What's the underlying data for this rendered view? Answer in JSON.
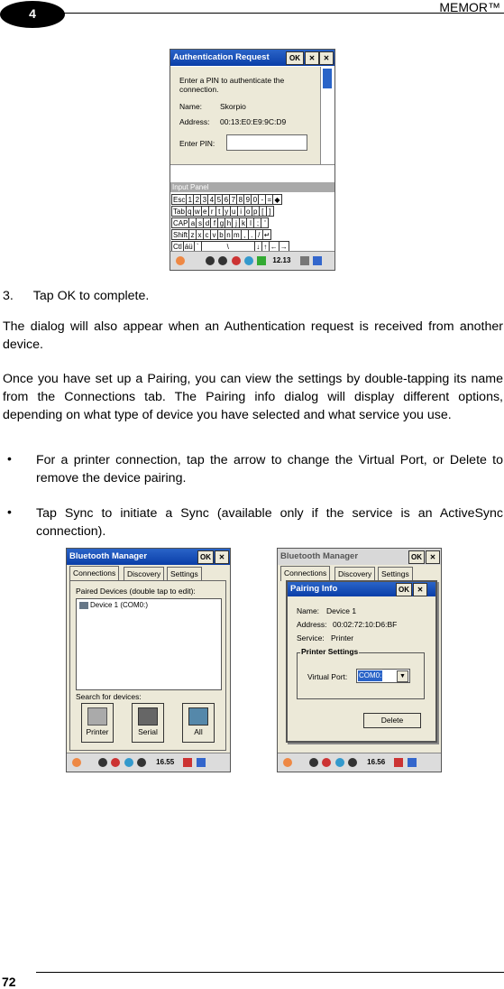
{
  "header": {
    "chapter": "4",
    "brand": "MEMOR™"
  },
  "footer": {
    "page_number": "72"
  },
  "screen1": {
    "title": "Authentication Request",
    "ok": "OK",
    "close": "✕",
    "message": "Enter a PIN to authenticate the connection.",
    "name_label": "Name:",
    "name_value": "Skorpio",
    "address_label": "Address:",
    "address_value": "00:13:E0:E9:9C:D9",
    "pin_label": "Enter PIN:",
    "input_panel": "Input Panel",
    "keyboard": {
      "row1": [
        "Esc",
        "1",
        "2",
        "3",
        "4",
        "5",
        "6",
        "7",
        "8",
        "9",
        "0",
        "-",
        "=",
        "◆"
      ],
      "row2": [
        "Tab",
        "q",
        "w",
        "e",
        "r",
        "t",
        "y",
        "u",
        "i",
        "o",
        "p",
        "[",
        "]"
      ],
      "row3": [
        "CAP",
        "a",
        "s",
        "d",
        "f",
        "g",
        "h",
        "j",
        "k",
        "l",
        ";",
        "'"
      ],
      "row4": [
        "Shift",
        "z",
        "x",
        "c",
        "v",
        "b",
        "n",
        "m",
        ",",
        ".",
        "/",
        "↵"
      ],
      "row5": [
        "Ctl",
        "áü",
        "`",
        "\\",
        "↓",
        "↑",
        "←",
        "→"
      ]
    },
    "clock": "12.13"
  },
  "steps": [
    {
      "number": "3.",
      "text": "Tap OK to complete."
    }
  ],
  "paragraphs": [
    "The dialog will also appear when an Authentication request is received from another device.",
    "Once you have set up a Pairing, you can view the settings by double-tapping its name from the Connections tab. The Pairing info dialog will display different options, depending on what type of device you have selected and what service you use."
  ],
  "bullets": [
    {
      "symbol": "•",
      "text": "For a printer connection, tap the arrow to change the Virtual Port, or Delete to remove the device pairing."
    },
    {
      "symbol": "•",
      "text": "Tap Sync to initiate a Sync (available only if the service is an ActiveSync connection)."
    }
  ],
  "screen2": {
    "title": "Bluetooth Manager",
    "ok": "OK",
    "close": "✕",
    "tabs": [
      "Connections",
      "Discovery",
      "Settings"
    ],
    "paired_label": "Paired Devices (double tap to edit):",
    "paired_item": "Device 1 (COM0:)",
    "search_label": "Search for devices:",
    "buttons": [
      "Printer",
      "Serial",
      "All"
    ],
    "clock": "16.55"
  },
  "screen3": {
    "title": "Bluetooth Manager",
    "ok": "OK",
    "close": "✕",
    "tabs": [
      "Connections",
      "Discovery",
      "Settings"
    ],
    "dialog_title": "Pairing Info",
    "name_label": "Name:",
    "name_value": "Device 1",
    "address_label": "Address:",
    "address_value": "00:02:72:10:D6:BF",
    "service_label": "Service:",
    "service_value": "Printer",
    "group_label": "Printer Settings",
    "port_label": "Virtual Port:",
    "port_value": "COM0:",
    "delete": "Delete",
    "clock": "16.56"
  }
}
